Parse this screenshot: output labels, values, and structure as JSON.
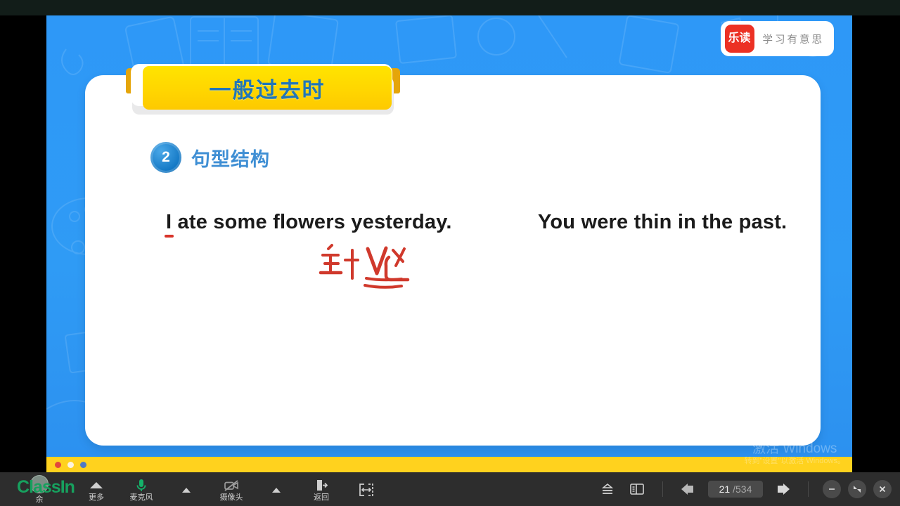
{
  "window": {
    "top_strip_color": "#121d19",
    "toolbar_bg": "#2d2d2d"
  },
  "slide": {
    "bg_color": "#2f9bf5",
    "footer_color": "#ffd21e",
    "brand": {
      "mark_text": "乐读",
      "mark_color": "#ec3124",
      "tagline": "学习有意思"
    },
    "ribbon": {
      "title": "一般过去时",
      "title_color": "#2176b7",
      "body_color": "#ffd400",
      "fold_color": "#e5a50a"
    },
    "section": {
      "number": "2",
      "label": "句型结构",
      "label_color": "#3f8fd4"
    },
    "sentences": [
      {
        "lead": "I",
        "rest": " ate some flowers yesterday.",
        "underline_color": "#d8342a"
      },
      {
        "lead": "",
        "rest": "You were thin in the past.",
        "underline_color": ""
      }
    ],
    "annotation": {
      "text": "主 + V过",
      "ink_color": "#d0392c"
    },
    "dots": [
      {
        "name": "dot-red",
        "color": "#e2483c"
      },
      {
        "name": "dot-cream",
        "color": "#fdf3de"
      },
      {
        "name": "dot-blue",
        "color": "#4f79c4"
      }
    ]
  },
  "watermark": {
    "line1": "激活 Windows",
    "line2": "转到\"设置\"以激活 Windows。"
  },
  "toolbar": {
    "left_items": [
      {
        "icon": "user-avatar-icon",
        "label": "余"
      },
      {
        "icon": "more-icon",
        "label": "更多"
      },
      {
        "icon": "microphone-icon",
        "label": "麦克风",
        "state": "on"
      },
      {
        "icon": "camera-off-icon",
        "label": "摄像头",
        "state": "off"
      },
      {
        "icon": "exit-icon",
        "label": "返回"
      },
      {
        "icon": "resize-icon",
        "label": ""
      }
    ],
    "logo_text": "ClassIn",
    "right": {
      "layers_icon": "layers-icon",
      "panel_icon": "panel-icon",
      "prev_icon": "prev-page-icon",
      "next_icon": "next-page-icon",
      "page_current": "21",
      "page_total": "/534",
      "minimize_icon": "minimize-icon",
      "restore_icon": "restore-icon",
      "close_icon": "close-icon"
    }
  }
}
